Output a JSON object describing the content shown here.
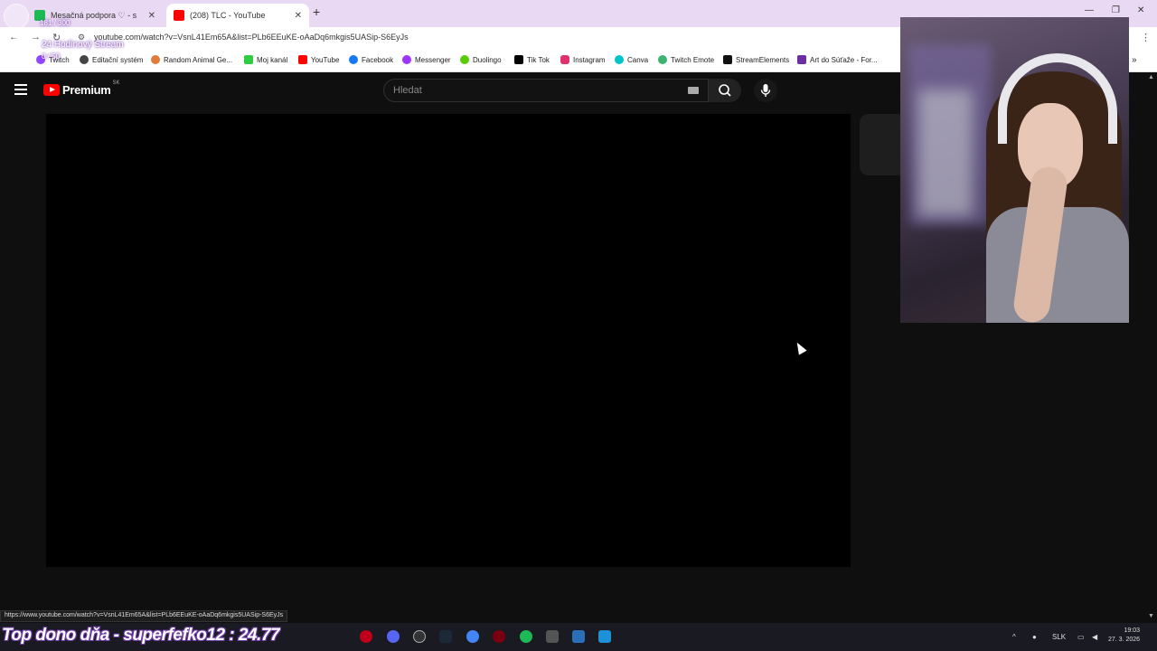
{
  "browser": {
    "tabs": [
      {
        "title": "Mesačná podpora ♡ - s",
        "active": false,
        "favicon_color": "#1db954"
      },
      {
        "title": "(208) TLC - YouTube",
        "active": true,
        "favicon_color": "#ff0000"
      }
    ],
    "url": "youtube.com/watch?v=VsnL41Em65A&list=PLb6EEuKE-oAaDq6mkgis5UASip-S6EyJs",
    "new_tab_glyph": "+",
    "close_glyph": "✕",
    "window_controls": [
      "—",
      "❐",
      "✕"
    ],
    "bookmarks": [
      {
        "label": "Twitch",
        "color": "#9146ff"
      },
      {
        "label": "Editační systém",
        "color": "#444444"
      },
      {
        "label": "Random Animal Ge...",
        "color": "#e07b39"
      },
      {
        "label": "Moj kanál",
        "color": "#2ecc40"
      },
      {
        "label": "YouTube",
        "color": "#ff0000"
      },
      {
        "label": "Facebook",
        "color": "#1877f2"
      },
      {
        "label": "Messenger",
        "color": "#a033ff"
      },
      {
        "label": "Duolingo",
        "color": "#58cc02"
      },
      {
        "label": "Tik Tok",
        "color": "#000000"
      },
      {
        "label": "Instagram",
        "color": "#e1306c"
      },
      {
        "label": "Canva",
        "color": "#00c4cc"
      },
      {
        "label": "Twitch Emote",
        "color": "#3cb371"
      },
      {
        "label": "StreamElements",
        "color": "#111111"
      },
      {
        "label": "Art do Súťaže - For...",
        "color": "#6b2fa0"
      }
    ],
    "more_bookmarks_glyph": "»",
    "status_url": "https://www.youtube.com/watch?v=VsnL41Em65A&list=PLb6EEuKE-oAaDq6mkgis5UASip-S6EyJs"
  },
  "youtube": {
    "logo_text": "Premium",
    "region": "SK",
    "search_placeholder": "Hledat",
    "brand_color": "#ff0000"
  },
  "overlay": {
    "goal_count": "181 / 300",
    "stream_title": "24 Hodinový Stream",
    "stream_sub": "0 / 50",
    "donation_banner": "Top dono dňa - superfefko12 : 24.77"
  },
  "taskbar": {
    "language": "SLK",
    "time": "19:03",
    "date": "27. 3. 2026"
  }
}
